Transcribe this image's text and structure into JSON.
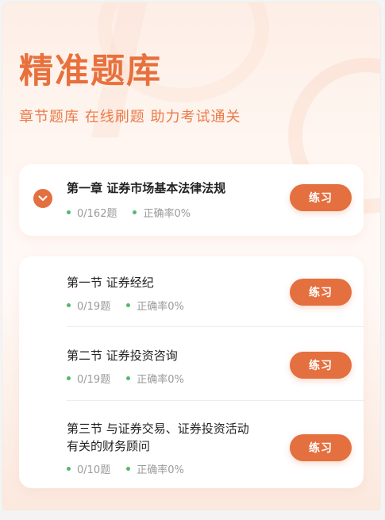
{
  "hero": {
    "title": "精准题库",
    "subtitle": "章节题库  在线刷题  助力考试通关"
  },
  "chapter": {
    "title": "第一章  证券市场基本法律法规",
    "progress": "0/162题",
    "accuracy": "正确率0%",
    "button": "练习",
    "icon": "chevron-down-icon",
    "expanded": true
  },
  "sections": [
    {
      "title": "第一节   证券经纪",
      "progress": "0/19题",
      "accuracy": "正确率0%",
      "button": "练习"
    },
    {
      "title": "第二节   证券投资咨询",
      "progress": "0/19题",
      "accuracy": "正确率0%",
      "button": "练习"
    },
    {
      "title_line1": "第三节   与证券交易、证券投资活动",
      "title_line2": "有关的财务顾问",
      "progress": "0/10题",
      "accuracy": "正确率0%",
      "button": "练习"
    }
  ],
  "colors": {
    "accent": "#e46f3f",
    "title": "#e8703c",
    "status_dot": "#54b96a"
  }
}
